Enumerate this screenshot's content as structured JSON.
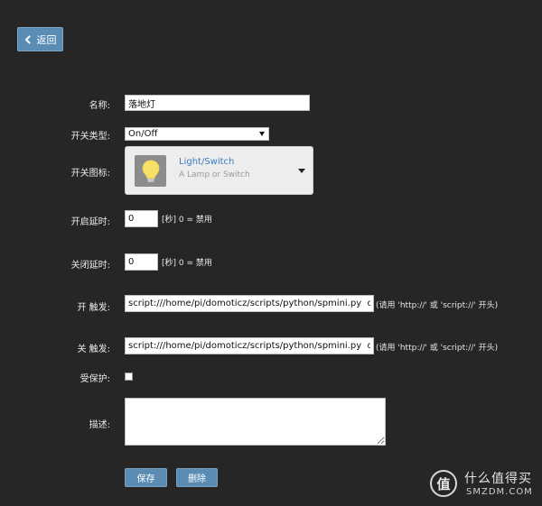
{
  "back": {
    "label": "返回"
  },
  "form": {
    "name_label": "名称:",
    "name_value": "落地灯",
    "switch_type_label": "开关类型:",
    "switch_type_value": "On/Off",
    "switch_icon_label": "开关图标:",
    "icon": {
      "title": "Light/Switch",
      "subtitle": "A Lamp or Switch",
      "name": "lightbulb-icon"
    },
    "on_delay_label": "开启延时:",
    "on_delay_value": "0",
    "on_delay_hint": "[秒] 0 = 禁用",
    "off_delay_label": "关闭延时:",
    "off_delay_value": "0",
    "off_delay_hint": "[秒] 0 = 禁用",
    "on_action_label": "开 触发:",
    "on_action_value": "script:///home/pi/domoticz/scripts/python/spmini.py  on",
    "on_action_hint": "(请用 'http://' 或 'script://' 开头)",
    "off_action_label": "关 触发:",
    "off_action_value": "script:///home/pi/domoticz/scripts/python/spmini.py  off",
    "off_action_hint": "(请用 'http://' 或 'script://' 开头)",
    "protected_label": "受保护:",
    "description_label": "描述:",
    "description_value": ""
  },
  "actions": {
    "save_label": "保存",
    "delete_label": "删除"
  },
  "watermark": {
    "badge": "值",
    "title": "什么值得买",
    "site": "SMZDM.COM"
  },
  "colors": {
    "background": "#262626",
    "button": "#5a8cb4",
    "link": "#3b7bbf"
  }
}
